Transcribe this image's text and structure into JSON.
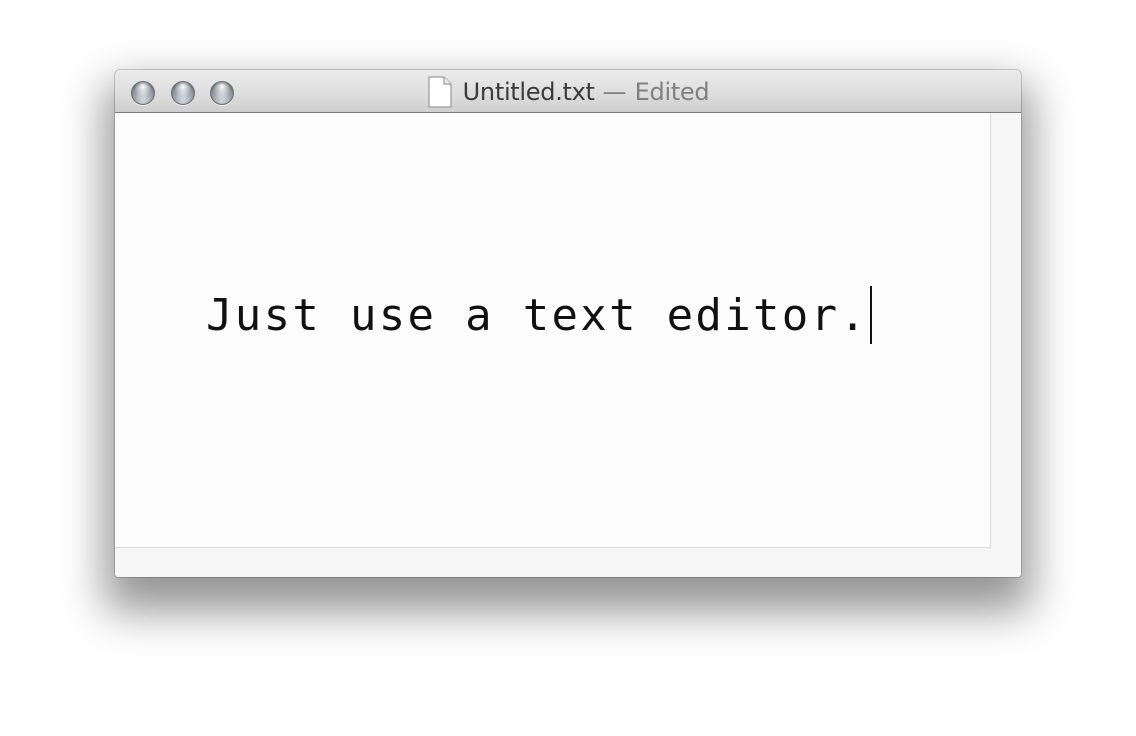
{
  "window": {
    "title": "Untitled.txt",
    "separator": "—",
    "status": "Edited",
    "controls": {
      "close_icon": "close-icon",
      "minimize_icon": "minimize-icon",
      "zoom_icon": "zoom-icon"
    },
    "title_icon": "document-icon"
  },
  "editor": {
    "text": "Just use a text editor."
  },
  "colors": {
    "text": "#111111",
    "title_text": "#3a3a3a",
    "title_secondary": "#808080",
    "editor_background": "#fdfdfd"
  }
}
